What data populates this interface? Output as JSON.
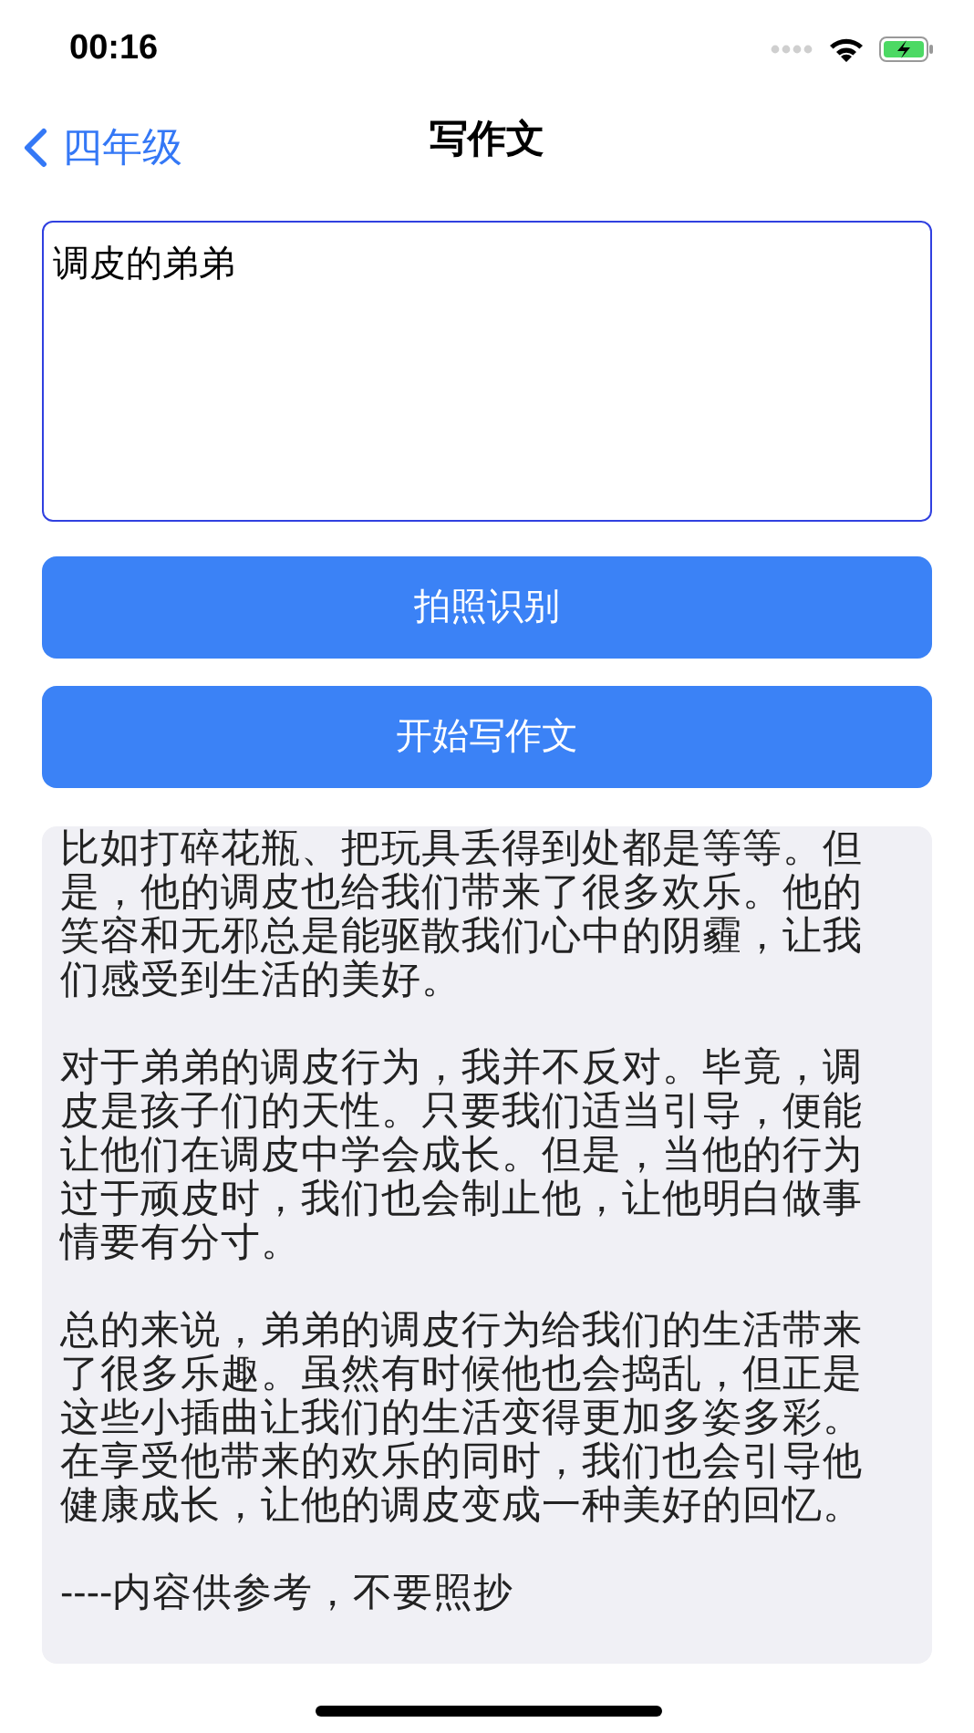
{
  "status_bar": {
    "time": "00:16"
  },
  "nav": {
    "back_label": "四年级",
    "title": "写作文"
  },
  "topic_field": {
    "value": "调皮的弟弟"
  },
  "buttons": [
    {
      "label": "拍照识别"
    },
    {
      "label": "开始写作文"
    }
  ],
  "essay": {
    "paragraphs": [
      "比如打碎花瓶、把玩具丢得到处都是等等。但是，他的调皮也给我们带来了很多欢乐。他的笑容和无邪总是能驱散我们心中的阴霾，让我们感受到生活的美好。",
      "对于弟弟的调皮行为，我并不反对。毕竟，调皮是孩子们的天性。只要我们适当引导，便能让他们在调皮中学会成长。但是，当他的行为过于顽皮时，我们也会制止他，让他明白做事情要有分寸。",
      "总的来说，弟弟的调皮行为给我们的生活带来了很多乐趣。虽然有时候他也会捣乱，但正是这些小插曲让我们的生活变得更加多姿多彩。在享受他带来的欢乐的同时，我们也会引导他健康成长，让他的调皮变成一种美好的回忆。",
      "----内容供参考，不要照抄"
    ]
  }
}
